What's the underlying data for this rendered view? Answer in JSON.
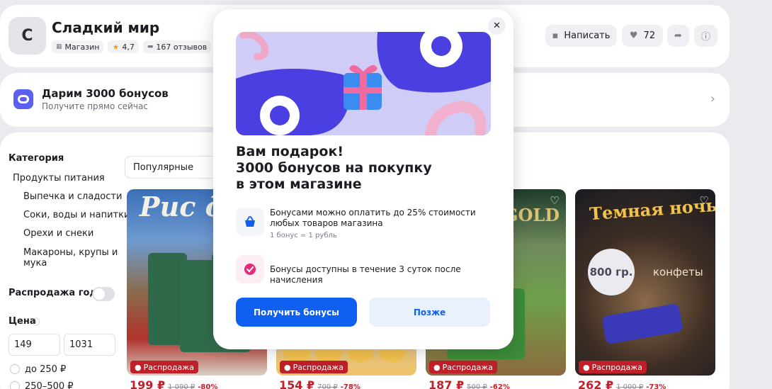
{
  "shop": {
    "avatar_letter": "С",
    "name": "Сладкий мир",
    "type_label": "Магазин",
    "rating": "4,7",
    "reviews": "167 отзывов"
  },
  "header_actions": {
    "write_label": "Написать",
    "likes_count": "72"
  },
  "promo": {
    "title": "Дарим 3000 бонусов",
    "subtitle": "Получите прямо сейчас"
  },
  "filters": {
    "category_title": "Категория",
    "items": [
      "Продукты питания",
      "Выпечка и сладости",
      "Соки, воды и напитки",
      "Орехи и снеки",
      "Макароны, крупы и",
      "мука"
    ],
    "sale_label": "Распродажа года",
    "price_title": "Цена",
    "price_min": "149",
    "price_max": "1031",
    "price_options": [
      "до 250 ₽",
      "250–500 ₽"
    ]
  },
  "sort": {
    "selected": "Популярные"
  },
  "products": [
    {
      "banner_text": "Рис для",
      "badge": "Распродажа",
      "price": "199 ₽",
      "old": "1 090 ₽",
      "discount": "-80%"
    },
    {
      "banner_text": "",
      "badge": "Распродажа",
      "price": "154 ₽",
      "old": "700 ₽",
      "discount": "-78%"
    },
    {
      "banner_text": "GOLD",
      "badge": "Распродажа",
      "price": "187 ₽",
      "old": "500 ₽",
      "discount": "-62%"
    },
    {
      "banner_text": "Темная ночь",
      "badge": "Распродажа",
      "price": "262 ₽",
      "old": "1 000 ₽",
      "discount": "-73%",
      "weight": "800 гр.",
      "type": "конфеты"
    }
  ],
  "modal": {
    "title_lines": [
      "Вам подарок!",
      "3000 бонусов на покупку",
      "в этом магазине"
    ],
    "feature1_text": "Бонусами можно оплатить до 25% стоимости любых товаров магазина",
    "feature1_sub": "1 бонус = 1 рубль",
    "feature2_text": "Бонусы доступны в течение 3 суток после начисления",
    "primary_button": "Получить бонусы",
    "secondary_button": "Позже"
  },
  "colors": {
    "accent": "#0f5ff0",
    "sale": "#c0202a",
    "brand": "#5a5ff0"
  }
}
